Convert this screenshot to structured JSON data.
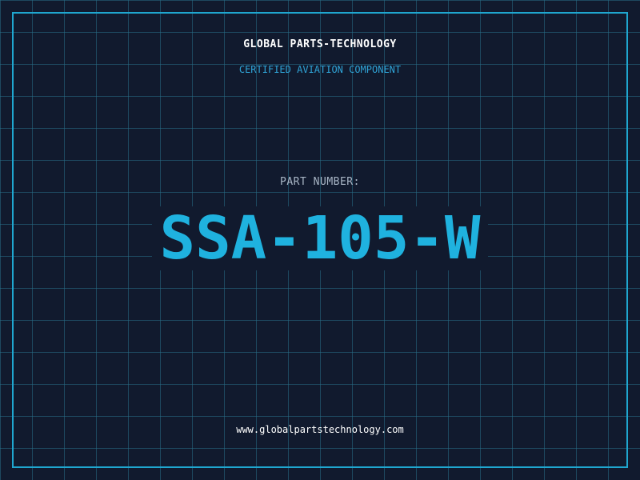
{
  "header": {
    "company_name": "GLOBAL PARTS-TECHNOLOGY",
    "tagline": "CERTIFIED AVIATION COMPONENT"
  },
  "part": {
    "label": "PART NUMBER:",
    "number": "SSA-105-W"
  },
  "footer": {
    "website": "www.globalpartstechnology.com"
  },
  "colors": {
    "background": "#111a2e",
    "grid": "#286e87",
    "accent": "#1fb2df",
    "text": "#ffffff",
    "label": "#a9b6c6"
  }
}
